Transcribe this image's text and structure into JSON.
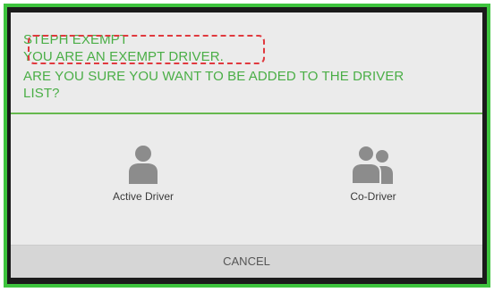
{
  "dialog": {
    "message_lines": [
      "STEPH EXEMPT",
      "YOU ARE AN EXEMPT DRIVER.",
      "ARE YOU SURE YOU WANT TO BE ADDED TO THE DRIVER",
      "LIST?"
    ],
    "options": [
      {
        "label": "Active Driver",
        "icon": "person-icon"
      },
      {
        "label": "Co-Driver",
        "icon": "two-people-icon"
      }
    ],
    "cancel_label": "CANCEL"
  },
  "colors": {
    "frame_border": "#3ec43e",
    "message_text": "#4aae46",
    "divider": "#66b84e",
    "highlight_dash": "#e0393e",
    "icon_gray": "#8c8c8c"
  }
}
